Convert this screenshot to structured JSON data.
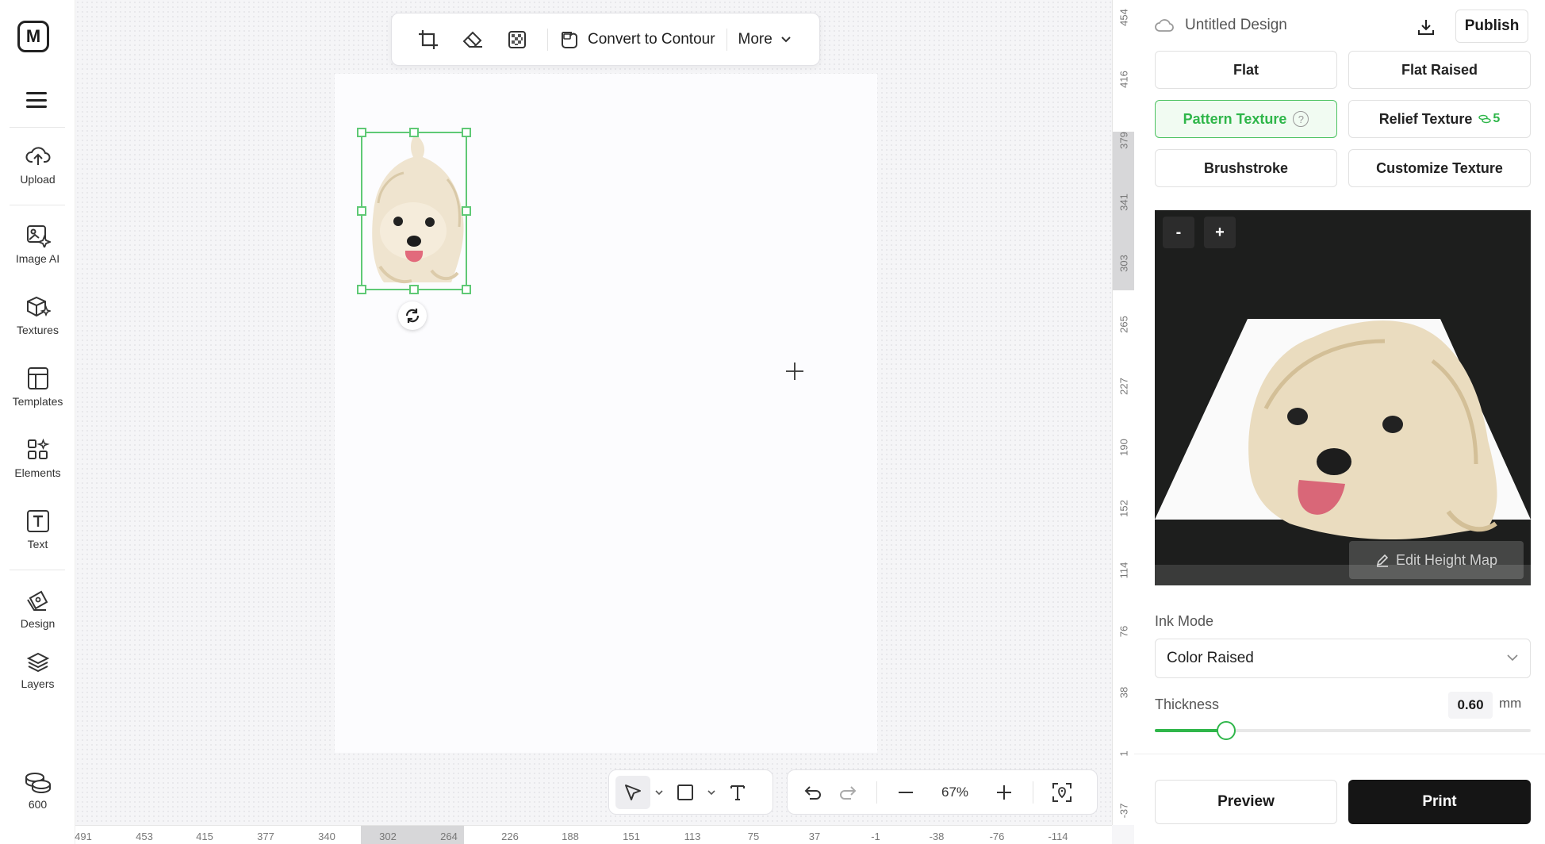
{
  "app": {
    "logo_letter": "M",
    "document_title": "Untitled Design",
    "publish_label": "Publish"
  },
  "sidebar": {
    "items": [
      {
        "label": "Upload",
        "icon": "upload-cloud-icon"
      },
      {
        "label": "Image AI",
        "icon": "image-ai-icon"
      },
      {
        "label": "Textures",
        "icon": "textures-icon"
      },
      {
        "label": "Templates",
        "icon": "templates-icon"
      },
      {
        "label": "Elements",
        "icon": "elements-icon"
      },
      {
        "label": "Text",
        "icon": "text-icon"
      },
      {
        "label": "Design",
        "icon": "design-icon"
      },
      {
        "label": "Layers",
        "icon": "layers-icon"
      }
    ],
    "credits": "600"
  },
  "top_toolbar": {
    "convert_label": "Convert to Contour",
    "more_label": "More"
  },
  "bottom_toolbar": {
    "zoom": "67%"
  },
  "rulers": {
    "horizontal": [
      "491",
      "453",
      "415",
      "377",
      "340",
      "302",
      "264",
      "226",
      "188",
      "151",
      "113",
      "75",
      "37",
      "-1",
      "-38",
      "-76",
      "-114"
    ],
    "vertical": [
      "454",
      "416",
      "379",
      "341",
      "303",
      "265",
      "227",
      "190",
      "152",
      "114",
      "76",
      "38",
      "1",
      "-37"
    ]
  },
  "panel": {
    "texture_options": {
      "flat": "Flat",
      "flat_raised": "Flat Raised",
      "pattern_texture": "Pattern Texture",
      "relief_texture": "Relief Texture",
      "relief_cost": "5",
      "brushstroke": "Brushstroke",
      "customize_texture": "Customize Texture"
    },
    "selected_texture": "Pattern Texture",
    "preview": {
      "zoom_out": "-",
      "zoom_in": "+",
      "edit_height_map": "Edit Height Map"
    },
    "ink_mode": {
      "label": "Ink Mode",
      "value": "Color Raised"
    },
    "thickness": {
      "label": "Thickness",
      "value": "0.60",
      "unit": "mm",
      "slider_fraction": 0.19
    },
    "preview_label": "Preview",
    "print_label": "Print"
  },
  "colors": {
    "accent_green": "#2fb64a",
    "selection_green": "#5fc975",
    "print_button_bg": "#151515"
  }
}
